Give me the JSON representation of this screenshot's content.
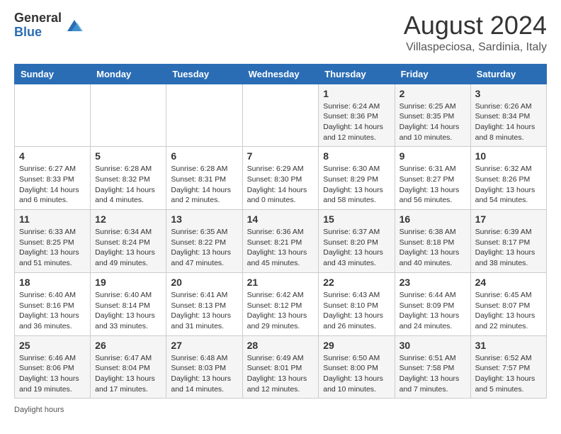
{
  "logo": {
    "general": "General",
    "blue": "Blue"
  },
  "header": {
    "title": "August 2024",
    "subtitle": "Villaspeciosa, Sardinia, Italy"
  },
  "days_of_week": [
    "Sunday",
    "Monday",
    "Tuesday",
    "Wednesday",
    "Thursday",
    "Friday",
    "Saturday"
  ],
  "weeks": [
    [
      {
        "day": "",
        "info": ""
      },
      {
        "day": "",
        "info": ""
      },
      {
        "day": "",
        "info": ""
      },
      {
        "day": "",
        "info": ""
      },
      {
        "day": "1",
        "info": "Sunrise: 6:24 AM\nSunset: 8:36 PM\nDaylight: 14 hours\nand 12 minutes."
      },
      {
        "day": "2",
        "info": "Sunrise: 6:25 AM\nSunset: 8:35 PM\nDaylight: 14 hours\nand 10 minutes."
      },
      {
        "day": "3",
        "info": "Sunrise: 6:26 AM\nSunset: 8:34 PM\nDaylight: 14 hours\nand 8 minutes."
      }
    ],
    [
      {
        "day": "4",
        "info": "Sunrise: 6:27 AM\nSunset: 8:33 PM\nDaylight: 14 hours\nand 6 minutes."
      },
      {
        "day": "5",
        "info": "Sunrise: 6:28 AM\nSunset: 8:32 PM\nDaylight: 14 hours\nand 4 minutes."
      },
      {
        "day": "6",
        "info": "Sunrise: 6:28 AM\nSunset: 8:31 PM\nDaylight: 14 hours\nand 2 minutes."
      },
      {
        "day": "7",
        "info": "Sunrise: 6:29 AM\nSunset: 8:30 PM\nDaylight: 14 hours\nand 0 minutes."
      },
      {
        "day": "8",
        "info": "Sunrise: 6:30 AM\nSunset: 8:29 PM\nDaylight: 13 hours\nand 58 minutes."
      },
      {
        "day": "9",
        "info": "Sunrise: 6:31 AM\nSunset: 8:27 PM\nDaylight: 13 hours\nand 56 minutes."
      },
      {
        "day": "10",
        "info": "Sunrise: 6:32 AM\nSunset: 8:26 PM\nDaylight: 13 hours\nand 54 minutes."
      }
    ],
    [
      {
        "day": "11",
        "info": "Sunrise: 6:33 AM\nSunset: 8:25 PM\nDaylight: 13 hours\nand 51 minutes."
      },
      {
        "day": "12",
        "info": "Sunrise: 6:34 AM\nSunset: 8:24 PM\nDaylight: 13 hours\nand 49 minutes."
      },
      {
        "day": "13",
        "info": "Sunrise: 6:35 AM\nSunset: 8:22 PM\nDaylight: 13 hours\nand 47 minutes."
      },
      {
        "day": "14",
        "info": "Sunrise: 6:36 AM\nSunset: 8:21 PM\nDaylight: 13 hours\nand 45 minutes."
      },
      {
        "day": "15",
        "info": "Sunrise: 6:37 AM\nSunset: 8:20 PM\nDaylight: 13 hours\nand 43 minutes."
      },
      {
        "day": "16",
        "info": "Sunrise: 6:38 AM\nSunset: 8:18 PM\nDaylight: 13 hours\nand 40 minutes."
      },
      {
        "day": "17",
        "info": "Sunrise: 6:39 AM\nSunset: 8:17 PM\nDaylight: 13 hours\nand 38 minutes."
      }
    ],
    [
      {
        "day": "18",
        "info": "Sunrise: 6:40 AM\nSunset: 8:16 PM\nDaylight: 13 hours\nand 36 minutes."
      },
      {
        "day": "19",
        "info": "Sunrise: 6:40 AM\nSunset: 8:14 PM\nDaylight: 13 hours\nand 33 minutes."
      },
      {
        "day": "20",
        "info": "Sunrise: 6:41 AM\nSunset: 8:13 PM\nDaylight: 13 hours\nand 31 minutes."
      },
      {
        "day": "21",
        "info": "Sunrise: 6:42 AM\nSunset: 8:12 PM\nDaylight: 13 hours\nand 29 minutes."
      },
      {
        "day": "22",
        "info": "Sunrise: 6:43 AM\nSunset: 8:10 PM\nDaylight: 13 hours\nand 26 minutes."
      },
      {
        "day": "23",
        "info": "Sunrise: 6:44 AM\nSunset: 8:09 PM\nDaylight: 13 hours\nand 24 minutes."
      },
      {
        "day": "24",
        "info": "Sunrise: 6:45 AM\nSunset: 8:07 PM\nDaylight: 13 hours\nand 22 minutes."
      }
    ],
    [
      {
        "day": "25",
        "info": "Sunrise: 6:46 AM\nSunset: 8:06 PM\nDaylight: 13 hours\nand 19 minutes."
      },
      {
        "day": "26",
        "info": "Sunrise: 6:47 AM\nSunset: 8:04 PM\nDaylight: 13 hours\nand 17 minutes."
      },
      {
        "day": "27",
        "info": "Sunrise: 6:48 AM\nSunset: 8:03 PM\nDaylight: 13 hours\nand 14 minutes."
      },
      {
        "day": "28",
        "info": "Sunrise: 6:49 AM\nSunset: 8:01 PM\nDaylight: 13 hours\nand 12 minutes."
      },
      {
        "day": "29",
        "info": "Sunrise: 6:50 AM\nSunset: 8:00 PM\nDaylight: 13 hours\nand 10 minutes."
      },
      {
        "day": "30",
        "info": "Sunrise: 6:51 AM\nSunset: 7:58 PM\nDaylight: 13 hours\nand 7 minutes."
      },
      {
        "day": "31",
        "info": "Sunrise: 6:52 AM\nSunset: 7:57 PM\nDaylight: 13 hours\nand 5 minutes."
      }
    ]
  ],
  "footer": {
    "daylight_label": "Daylight hours"
  }
}
